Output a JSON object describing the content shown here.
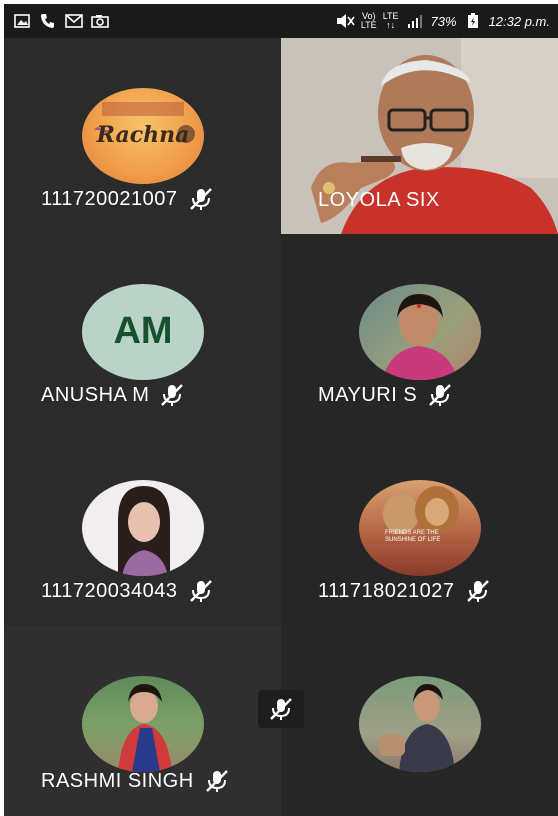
{
  "status_bar": {
    "battery": "73%",
    "time": "12:32 p.m.",
    "net_volte": "Vo)\nLTE",
    "net_lte": "LTE\n↑↓"
  },
  "participants": [
    {
      "name": "111720021007",
      "avatar": "rachna-logo-avatar",
      "muted": true,
      "avatar_text": "Rachna"
    },
    {
      "name": "LOYOLA SIX",
      "avatar": "video-feed",
      "muted": false
    },
    {
      "name": "ANUSHA M",
      "avatar": "initials-avatar",
      "initials": "AM",
      "muted": true
    },
    {
      "name": "MAYURI S",
      "avatar": "photo-avatar",
      "muted": true
    },
    {
      "name": "111720034043",
      "avatar": "photo-avatar",
      "muted": true
    },
    {
      "name": "111718021027",
      "avatar": "lions-photo-avatar",
      "muted": true,
      "avatar_text": "FRIENDS ARE THE SUNSHINE OF LIFE"
    },
    {
      "name": "RASHMI SINGH",
      "avatar": "photo-avatar",
      "muted": true
    },
    {
      "name": "",
      "avatar": "photo-avatar",
      "muted": false
    }
  ],
  "colors": {
    "tile_bg": "#2b2b2b",
    "initials_avatar_bg": "#b9d3c6",
    "initials_text": "#17502f"
  }
}
